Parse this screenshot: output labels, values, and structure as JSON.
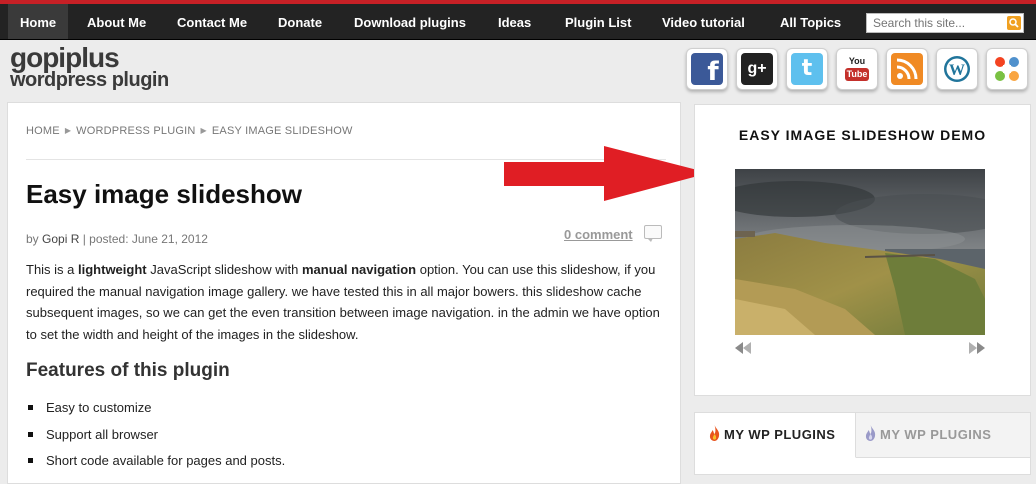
{
  "nav": {
    "items": [
      {
        "label": "Home",
        "active": true
      },
      {
        "label": "About Me"
      },
      {
        "label": "Contact Me"
      },
      {
        "label": "Donate"
      },
      {
        "label": "Download plugins"
      },
      {
        "label": "Ideas"
      },
      {
        "label": "Plugin List"
      },
      {
        "label": "Video tutorial"
      },
      {
        "label": "All Topics"
      }
    ],
    "search_placeholder": "Search this site..."
  },
  "logo": {
    "line1": "gopiplus",
    "line2": "wordpress plugin"
  },
  "social": [
    {
      "icon": "facebook-icon",
      "glyph": "f",
      "color": "#3b5998"
    },
    {
      "icon": "google-plus-icon",
      "glyph": "g+",
      "color": "#222222"
    },
    {
      "icon": "twitter-icon",
      "glyph": "t",
      "color": "#4fb3e8"
    },
    {
      "icon": "youtube-icon",
      "glyph": "You Tube",
      "color": "#c4302b"
    },
    {
      "icon": "rss-icon",
      "glyph": "rss",
      "color": "#f08a24"
    },
    {
      "icon": "wordpress-icon",
      "glyph": "W",
      "color": "#21759b"
    },
    {
      "icon": "joomla-icon",
      "glyph": "J",
      "color": "#ffffff"
    }
  ],
  "breadcrumb": [
    "HOME",
    "WORDPRESS PLUGIN",
    "EASY IMAGE SLIDESHOW"
  ],
  "post": {
    "title": "Easy image slideshow",
    "meta_by": "by",
    "author": "Gopi R",
    "meta_posted": "| posted: June 21, 2012",
    "comment_link": "0 comment",
    "intro_1": "This is a ",
    "intro_bold_1": "lightweight",
    "intro_2": " JavaScript slideshow with ",
    "intro_bold_2": "manual navigation",
    "intro_3": " option. You can use this slideshow, if you required the manual navigation image gallery. we have tested this in all major bowers. this slideshow cache subsequent images, so we can get the even transition between image navigation. in the admin we have option to set the width and height of the images in the slideshow.",
    "features_heading": "Features of this plugin",
    "features": [
      "Easy to customize",
      "Support all browser",
      "Short code available for pages and posts."
    ]
  },
  "sidebar": {
    "demo_title": "EASY IMAGE SLIDESHOW DEMO"
  },
  "tabs": {
    "active_label": "MY WP PLUGINS",
    "inactive_label": "MY WP PLUGINS"
  },
  "colors": {
    "accent_red": "#e01e24",
    "nav_bg": "#232323",
    "topline": "#c62026"
  }
}
